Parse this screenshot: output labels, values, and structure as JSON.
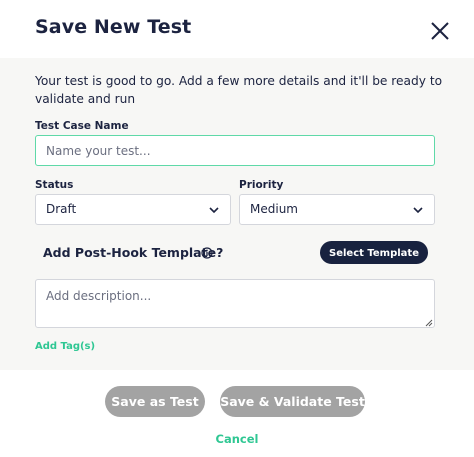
{
  "dialog": {
    "title": "Save New Test",
    "close_icon": "close-icon"
  },
  "intro_text": "Your test is good to go. Add a few more details and it'll be ready to validate and run",
  "test_case": {
    "label": "Test Case Name",
    "value": "",
    "placeholder": "Name your test..."
  },
  "status": {
    "label": "Status",
    "selected": "Draft"
  },
  "priority": {
    "label": "Priority",
    "selected": "Medium"
  },
  "post_hook": {
    "label": "Add Post-Hook Template?",
    "info_icon": "info-icon",
    "button_label": "Select Template"
  },
  "description": {
    "value": "",
    "placeholder": "Add description..."
  },
  "add_tags_label": "Add Tag(s)",
  "footer": {
    "save_label": "Save as Test",
    "save_validate_label": "Save & Validate Test",
    "cancel_label": "Cancel"
  },
  "colors": {
    "primary_text": "#1c2340",
    "accent_green": "#2fc793",
    "focus_border": "#5fd9a8",
    "dark_button": "#18223f",
    "disabled_button": "#a3a3a3",
    "panel_bg": "#f7f7f5"
  }
}
